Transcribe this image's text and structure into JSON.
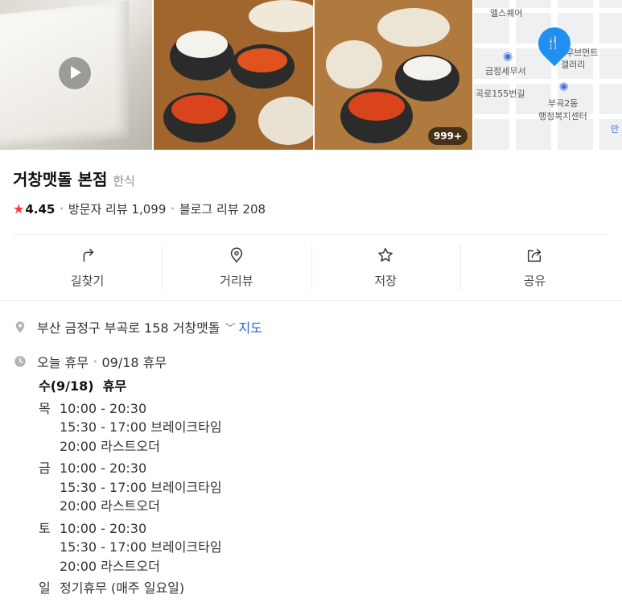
{
  "photos": {
    "more_count": "999+",
    "map_labels": {
      "top": "엘스퀘어",
      "office": "금정세무서",
      "road": "곡로155번길",
      "gallery_1": "무브먼트",
      "gallery_2": "갤러리",
      "dong_1": "부곡2동",
      "dong_2": "행정복지센터",
      "edge": "만"
    }
  },
  "place": {
    "name": "거창맷돌 본점",
    "category": "한식",
    "rating": "4.45",
    "visitor_review_label": "방문자 리뷰",
    "visitor_review_count": "1,099",
    "blog_review_label": "블로그 리뷰",
    "blog_review_count": "208"
  },
  "actions": [
    {
      "label": "길찾기",
      "icon": "directions-icon"
    },
    {
      "label": "거리뷰",
      "icon": "streetview-pin-icon"
    },
    {
      "label": "저장",
      "icon": "star-outline-icon"
    },
    {
      "label": "공유",
      "icon": "share-icon"
    }
  ],
  "address": {
    "text": "부산 금정구 부곡로 158 거창맷돌",
    "map_link": "지도"
  },
  "hours": {
    "status": "오늘 휴무",
    "status_detail": "09/18 휴무",
    "today_label": "수(9/18)  휴무",
    "days": [
      {
        "day": "목",
        "lines": [
          "10:00 - 20:30",
          "15:30 - 17:00 브레이크타임",
          "20:00 라스트오더"
        ]
      },
      {
        "day": "금",
        "lines": [
          "10:00 - 20:30",
          "15:30 - 17:00 브레이크타임",
          "20:00 라스트오더"
        ]
      },
      {
        "day": "토",
        "lines": [
          "10:00 - 20:30",
          "15:30 - 17:00 브레이크타임",
          "20:00 라스트오더"
        ]
      },
      {
        "day": "일",
        "lines": [
          "정기휴무 (매주 일요일)"
        ]
      }
    ]
  },
  "colors": {
    "star": "#f53a3a",
    "link": "#2b62e0",
    "pin": "#1f8ff0"
  }
}
